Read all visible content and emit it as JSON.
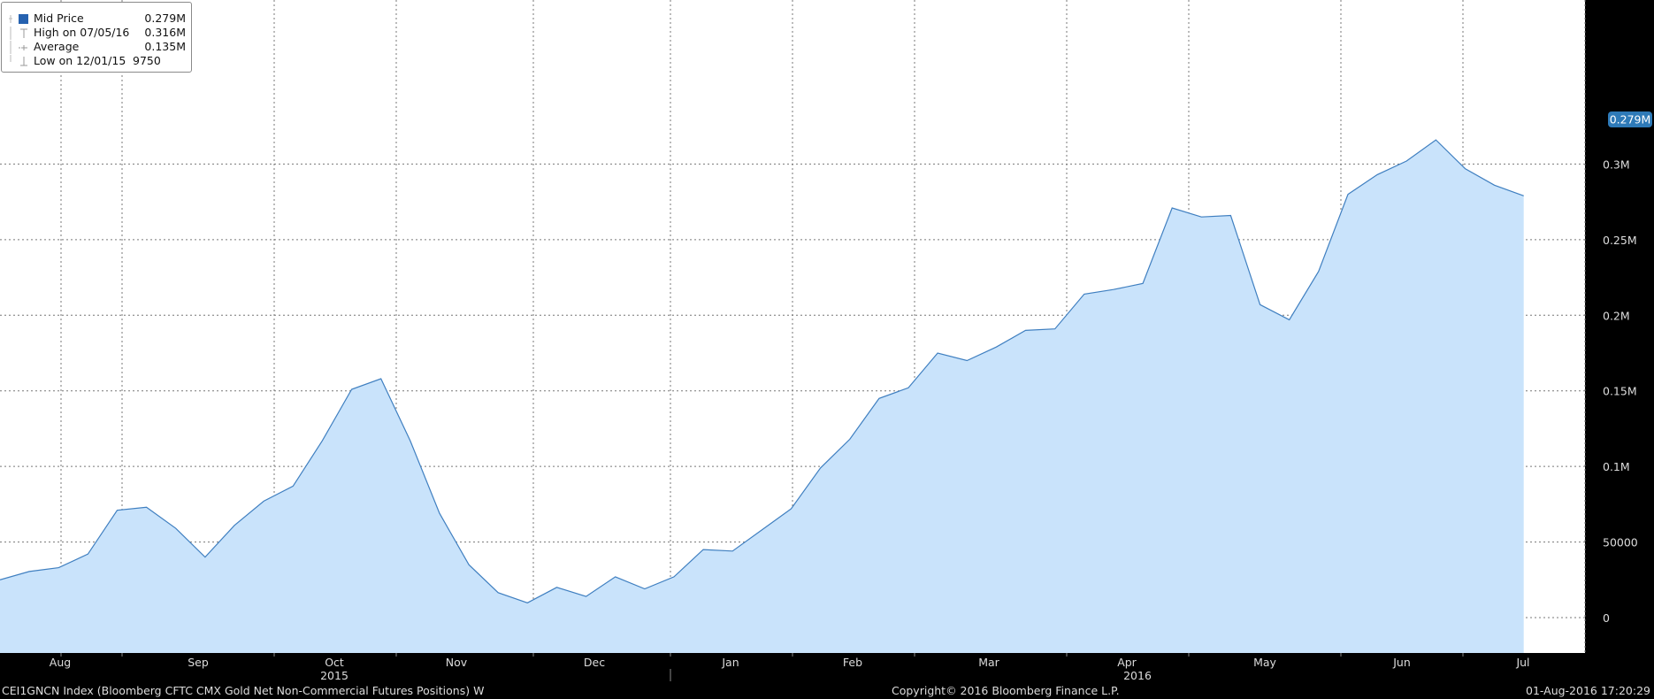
{
  "chart_data": {
    "type": "area",
    "x": [
      "2015-07-14",
      "2015-07-21",
      "2015-07-28",
      "2015-08-04",
      "2015-08-11",
      "2015-08-18",
      "2015-08-25",
      "2015-09-01",
      "2015-09-08",
      "2015-09-15",
      "2015-09-22",
      "2015-09-29",
      "2015-10-06",
      "2015-10-13",
      "2015-10-20",
      "2015-10-27",
      "2015-11-03",
      "2015-11-10",
      "2015-11-17",
      "2015-11-24",
      "2015-12-01",
      "2015-12-08",
      "2015-12-15",
      "2015-12-22",
      "2015-12-29",
      "2016-01-05",
      "2016-01-12",
      "2016-01-19",
      "2016-01-26",
      "2016-02-02",
      "2016-02-09",
      "2016-02-16",
      "2016-02-23",
      "2016-03-01",
      "2016-03-08",
      "2016-03-15",
      "2016-03-22",
      "2016-03-29",
      "2016-04-05",
      "2016-04-12",
      "2016-04-19",
      "2016-04-26",
      "2016-05-03",
      "2016-05-10",
      "2016-05-17",
      "2016-05-24",
      "2016-05-31",
      "2016-06-07",
      "2016-06-14",
      "2016-06-21",
      "2016-06-28",
      "2016-07-05",
      "2016-07-12",
      "2016-07-19",
      "2016-07-26"
    ],
    "series": [
      {
        "name": "Mid Price",
        "values": [
          25000,
          30500,
          33000,
          42000,
          71000,
          73000,
          59000,
          40000,
          61000,
          77000,
          87000,
          117000,
          151000,
          158000,
          117000,
          69000,
          35000,
          16500,
          9750,
          20000,
          14000,
          27000,
          19000,
          27000,
          45000,
          44000,
          58000,
          72000,
          99000,
          118000,
          145000,
          152000,
          175000,
          170000,
          179000,
          190000,
          191000,
          214000,
          217000,
          221000,
          271000,
          265000,
          266000,
          207000,
          197000,
          229000,
          280000,
          293000,
          302000,
          316000,
          297000,
          286000,
          279000
        ]
      }
    ],
    "x_tick_labels": [
      "Aug",
      "Sep",
      "Oct",
      "Nov",
      "Dec",
      "Jan",
      "Feb",
      "Mar",
      "Apr",
      "May",
      "Jun",
      "Jul"
    ],
    "x_year_labels": [
      "2015",
      "2016"
    ],
    "y_tick_labels": [
      "0",
      "50000",
      "0.1M",
      "0.15M",
      "0.2M",
      "0.25M",
      "0.3M"
    ],
    "y_ticks": [
      0,
      50000,
      100000,
      150000,
      200000,
      250000,
      300000
    ],
    "ylim": [
      -20000,
      340000
    ],
    "last_value_label": "0.279M",
    "legend": [
      {
        "label": "Mid Price",
        "value": "0.279M"
      },
      {
        "label": "High on 07/05/16",
        "value": "0.316M"
      },
      {
        "label": "Average",
        "value": "0.135M"
      },
      {
        "label": "Low on 12/01/15",
        "value": "9750"
      }
    ],
    "grid": true,
    "legend_position": "top-left"
  },
  "footer": {
    "ticker": "CEI1GNCN Index (Bloomberg CFTC CMX Gold Net Non-Commercial Futures Positions)  W",
    "copyright": "Copyright© 2016 Bloomberg Finance L.P.",
    "timestamp": "01-Aug-2016 17:20:29"
  },
  "colors": {
    "fill": "#c9e3fb",
    "line": "#3f7fc0",
    "background": "#000000",
    "plot": "#ffffff",
    "badge": "#2e7ab8",
    "legend_marker": "#2662b0"
  }
}
